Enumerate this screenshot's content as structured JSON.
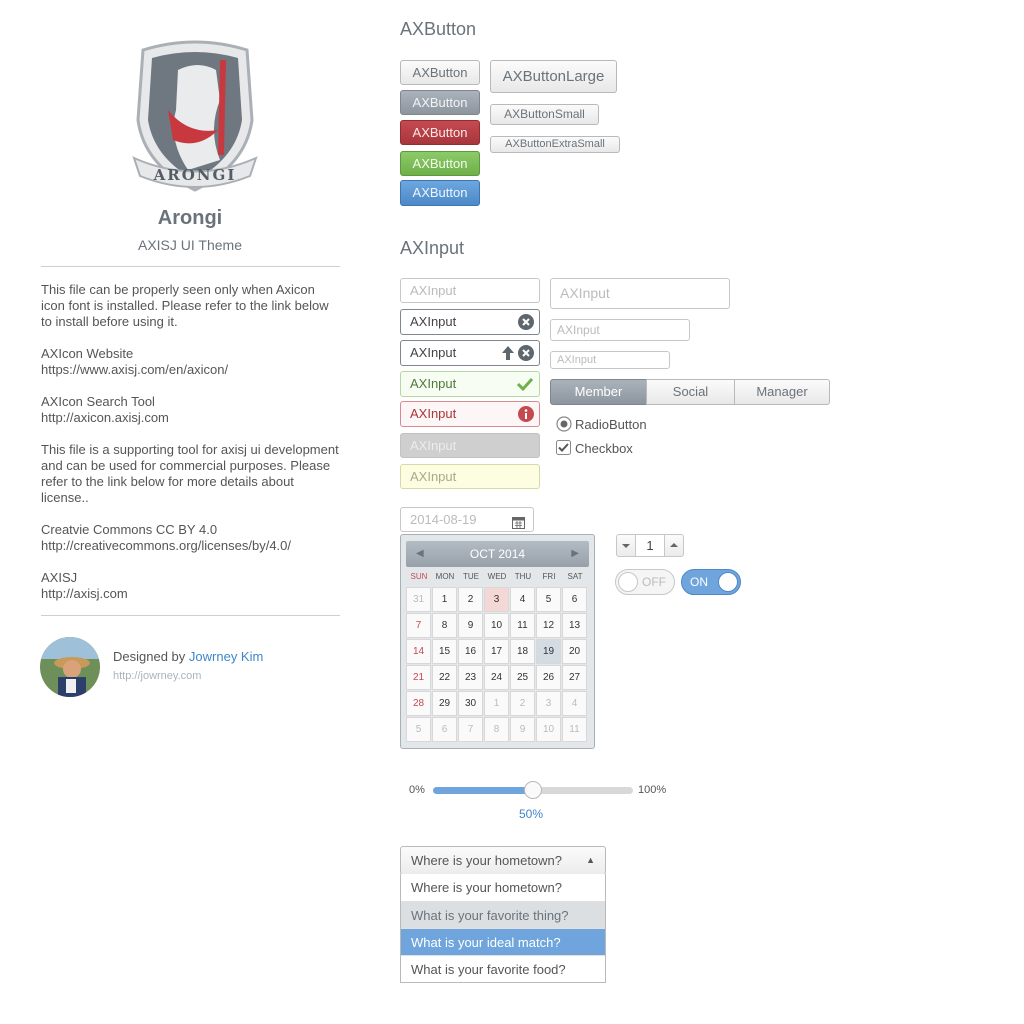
{
  "left": {
    "brand_name": "Arongi",
    "brand_subtitle": "AXISJ UI Theme",
    "logo_text": "ARONGI",
    "paragraphs": [
      "This file can be properly seen only when Axicon icon font is installed. Please refer to the link below to install before using it.",
      "AXIcon Website",
      "https://www.axisj.com/en/axicon/",
      "AXIcon Search Tool",
      "http://axicon.axisj.com",
      "This file is a supporting tool for axisj ui development and can be used for commercial purposes. Please refer to the link below for more details about license..",
      "Creatvie Commons CC BY 4.0",
      "http://creativecommons.org/licenses/by/4.0/",
      "AXISJ",
      "http://axisj.com"
    ],
    "designed_by": "Designed by",
    "designer_name": "Jowrney Kim",
    "designer_url": "http://jowrney.com"
  },
  "buttons": {
    "title": "AXButton",
    "default": "AXButton",
    "gray": "AXButton",
    "red": "AXButton",
    "green": "AXButton",
    "blue": "AXButton",
    "large": "AXButtonLarge",
    "small": "AXButtonSmall",
    "xsmall": "AXButtonExtraSmall"
  },
  "inputs": {
    "title": "AXInput",
    "placeholder": "AXInput",
    "value": "AXInput",
    "segmented": [
      "Member",
      "Social",
      "Manager"
    ],
    "radio_label": "RadioButton",
    "checkbox_label": "Checkbox",
    "date_value": "2014-08-19"
  },
  "calendar": {
    "month_label": "OCT 2014",
    "weekdays": [
      "SUN",
      "MON",
      "TUE",
      "WED",
      "THU",
      "FRI",
      "SAT"
    ],
    "weeks": [
      [
        "31",
        "1",
        "2",
        "3",
        "4",
        "5",
        "6"
      ],
      [
        "7",
        "8",
        "9",
        "10",
        "11",
        "12",
        "13"
      ],
      [
        "14",
        "15",
        "16",
        "17",
        "18",
        "19",
        "20"
      ],
      [
        "21",
        "22",
        "23",
        "24",
        "25",
        "26",
        "27"
      ],
      [
        "28",
        "29",
        "30",
        "1",
        "2",
        "3",
        "4"
      ],
      [
        "5",
        "6",
        "7",
        "8",
        "9",
        "10",
        "11"
      ]
    ],
    "today": "3",
    "selected": "19"
  },
  "stepper": {
    "value": "1"
  },
  "switches": {
    "off_label": "OFF",
    "on_label": "ON"
  },
  "slider": {
    "min_label": "0%",
    "max_label": "100%",
    "value_label": "50%",
    "value": 0.5
  },
  "dropdown": {
    "selected": "Where is your hometown?",
    "options": [
      "Where is your hometown?",
      "What is your favorite thing?",
      "What is your ideal match?",
      "What is your favorite food?"
    ],
    "hover_index": 1,
    "active_index": 2
  },
  "colors": {
    "accent": "#6fa5dc",
    "red": "#c44a50",
    "green": "#7cbd57",
    "gray": "#8d969f"
  }
}
